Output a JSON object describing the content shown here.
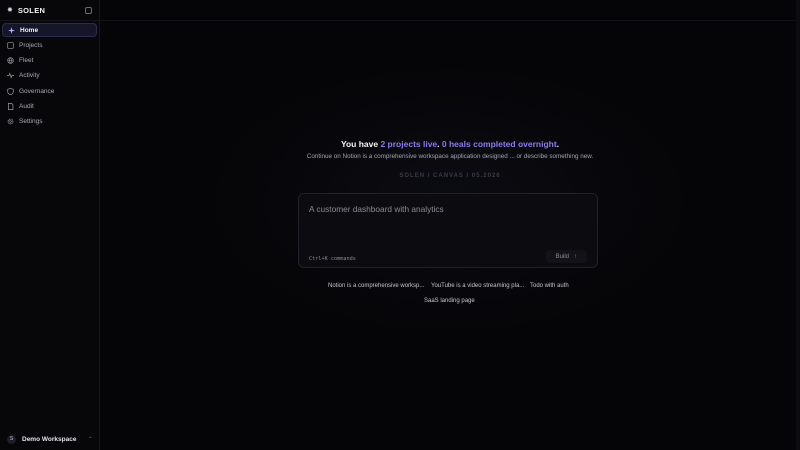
{
  "brand": {
    "logo": "✸",
    "name": "SOLEN"
  },
  "sidebar": {
    "items": [
      {
        "label": "Home",
        "icon": "sparkle-icon",
        "active": true
      },
      {
        "label": "Projects",
        "icon": "folder-icon"
      },
      {
        "label": "Fleet",
        "icon": "globe-icon"
      },
      {
        "label": "Activity",
        "icon": "activity-icon"
      },
      {
        "label": "Governance",
        "icon": "shield-icon"
      },
      {
        "label": "Audit",
        "icon": "document-icon"
      },
      {
        "label": "Settings",
        "icon": "gear-icon"
      }
    ]
  },
  "workspace": {
    "initial": "S",
    "name": "Demo Workspace",
    "caret": "⌃"
  },
  "hero": {
    "headline_pre": "You have ",
    "projects_live": "2 projects live",
    "mid": ". ",
    "heals": "0 heals completed overnight",
    "end": ".",
    "subline": "Continue on Notion is a comprehensive workspace application designed ... or describe something new.",
    "crumb": "SOLEN / CANVAS / 05.2026"
  },
  "prompt": {
    "placeholder": "A customer dashboard with analytics",
    "hint": "Ctrl+K commands",
    "build_label": "Build",
    "build_arrow": "↑"
  },
  "suggestions": [
    "Notion is a comprehensive worksp...",
    "YouTube is a video streaming pla...",
    "Todo with auth",
    "SaaS landing page"
  ],
  "colors": {
    "accent": "#8a7cf0",
    "background": "#050507"
  }
}
